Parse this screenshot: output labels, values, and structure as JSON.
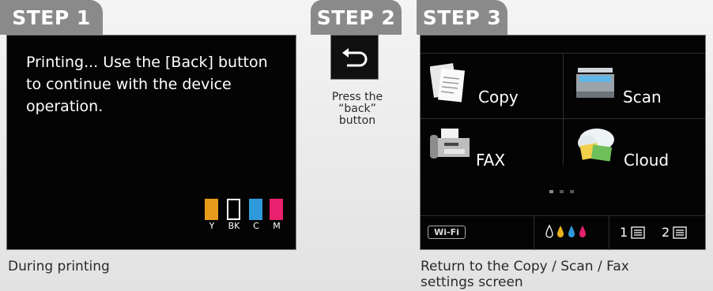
{
  "steps": {
    "step1": "STEP 1",
    "step2": "STEP 2",
    "step3": "STEP 3"
  },
  "step1_screen": {
    "message": "Printing... Use the [Back] button to continue with the device operation.",
    "inks": [
      {
        "label": "Y",
        "color": "#e89a1c"
      },
      {
        "label": "BK",
        "color": "#000000"
      },
      {
        "label": "C",
        "color": "#2f9ad9"
      },
      {
        "label": "M",
        "color": "#e8206e"
      }
    ],
    "caption": "During printing"
  },
  "step2": {
    "back_icon": "back-arrow-icon",
    "instruction_line1": "Press the",
    "instruction_line2": "“back”",
    "instruction_line3": "button"
  },
  "step3_screen": {
    "menu": {
      "copy": "Copy",
      "scan": "Scan",
      "fax": "FAX",
      "cloud": "Cloud"
    },
    "wifi_label": "Wi-Fi",
    "tray1": "1",
    "tray2": "2",
    "caption_line1": "Return to the Copy / Scan / Fax",
    "caption_line2": "settings screen"
  }
}
